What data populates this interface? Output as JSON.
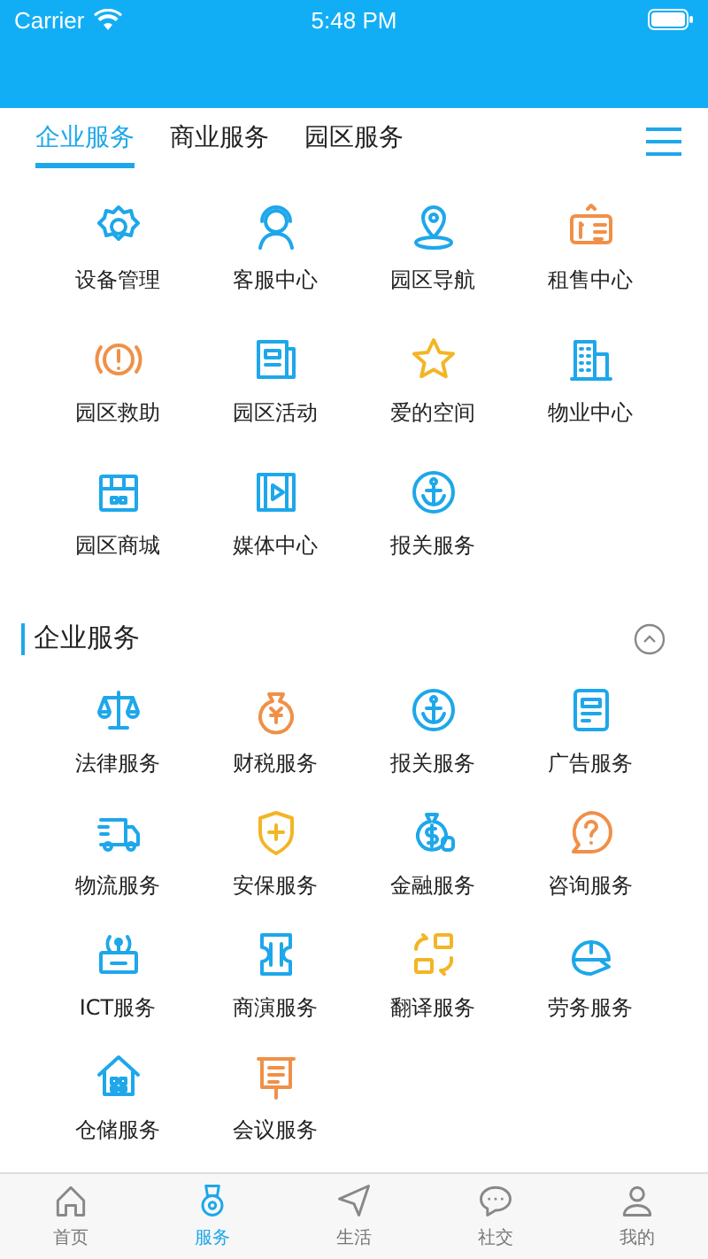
{
  "status_bar": {
    "carrier": "Carrier",
    "time": "5:48 PM"
  },
  "tabs": [
    {
      "label": "企业服务",
      "selected": true
    },
    {
      "label": "商业服务",
      "selected": false
    },
    {
      "label": "园区服务",
      "selected": false
    }
  ],
  "top_services": [
    "设备管理",
    "客服中心",
    "园区导航",
    "租售中心",
    "园区救助",
    "园区活动",
    "爱的空间",
    "物业中心",
    "园区商城",
    "媒体中心",
    "报关服务"
  ],
  "section": {
    "title": "企业服务",
    "expanded": true,
    "services": [
      "法律服务",
      "财税服务",
      "报关服务",
      "广告服务",
      "物流服务",
      "安保服务",
      "金融服务",
      "咨询服务",
      "ICT服务",
      "商演服务",
      "翻译服务",
      "劳务服务",
      "仓储服务",
      "会议服务"
    ]
  },
  "bottom_nav": [
    {
      "label": "首页",
      "selected": false
    },
    {
      "label": "服务",
      "selected": true
    },
    {
      "label": "生活",
      "selected": false
    },
    {
      "label": "社交",
      "selected": false
    },
    {
      "label": "我的",
      "selected": false
    }
  ]
}
